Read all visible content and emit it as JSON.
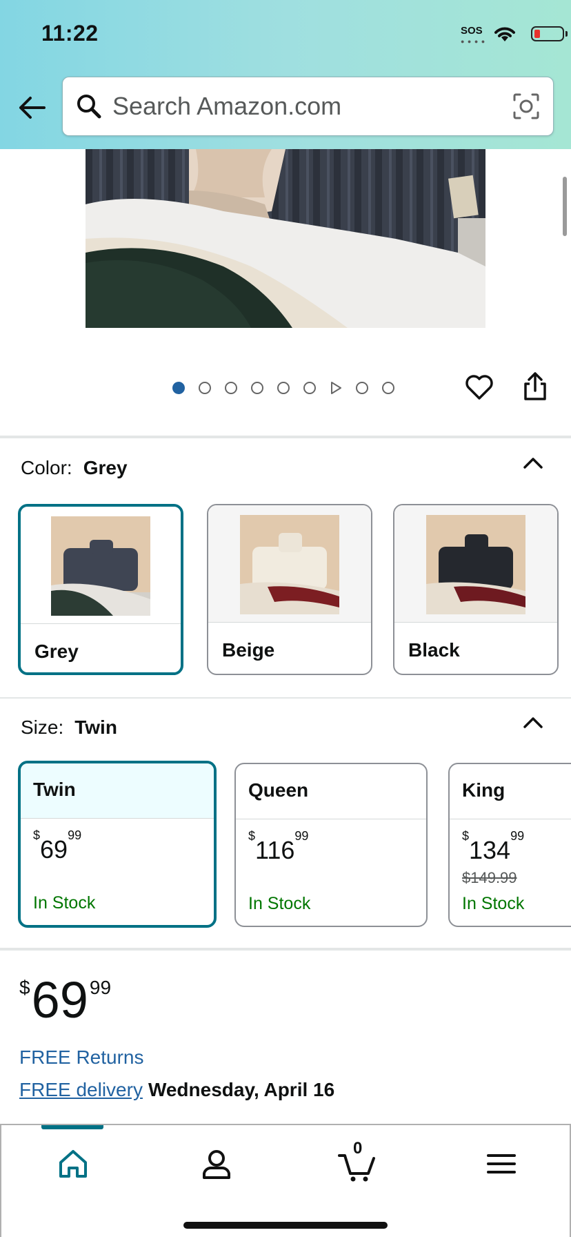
{
  "status_bar": {
    "time": "11:22",
    "sos": "SOS"
  },
  "search": {
    "placeholder": "Search Amazon.com"
  },
  "carousel": {
    "total": 9,
    "active_index": 0,
    "video_index": 6
  },
  "color": {
    "label": "Color:",
    "selected": "Grey",
    "options": [
      {
        "name": "Grey",
        "selected": true
      },
      {
        "name": "Beige",
        "selected": false
      },
      {
        "name": "Black",
        "selected": false
      }
    ]
  },
  "size": {
    "label": "Size:",
    "selected": "Twin",
    "options": [
      {
        "name": "Twin",
        "dollars": "69",
        "cents": "99",
        "currency": "$",
        "old_price": "",
        "stock": "In Stock",
        "selected": true
      },
      {
        "name": "Queen",
        "dollars": "116",
        "cents": "99",
        "currency": "$",
        "old_price": "",
        "stock": "In Stock",
        "selected": false
      },
      {
        "name": "King",
        "dollars": "134",
        "cents": "99",
        "currency": "$",
        "old_price": "$149.99",
        "stock": "In Stock",
        "selected": false
      }
    ]
  },
  "price": {
    "currency": "$",
    "dollars": "69",
    "cents": "99"
  },
  "returns": "FREE Returns",
  "delivery": {
    "link": "FREE delivery",
    "date": "Wednesday, April 16"
  },
  "nav": {
    "cart_count": "0",
    "items": [
      "home-icon",
      "account-icon",
      "cart-icon",
      "menu-icon"
    ]
  },
  "colors": {
    "accent": "#007185",
    "link": "#2162a1",
    "stock": "#007600"
  }
}
